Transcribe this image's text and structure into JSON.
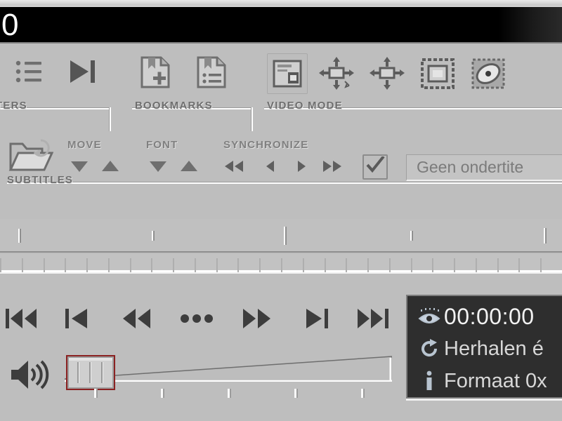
{
  "window": {
    "osd_text": "0",
    "background_color": "#bebebe",
    "video_area_color": "#000000"
  },
  "toolbar": {
    "groups": [
      {
        "caption": "TERS",
        "full_caption": "FILTERS",
        "buttons": [
          {
            "name": "filters-list-icon",
            "label": "Filters list"
          },
          {
            "name": "play-to-end-icon",
            "label": "Play to end"
          }
        ]
      },
      {
        "caption": "BOOKMARKS",
        "buttons": [
          {
            "name": "add-bookmark-icon",
            "label": "Add bookmark"
          },
          {
            "name": "bookmark-list-icon",
            "label": "Bookmark list"
          }
        ]
      },
      {
        "caption": "VIDEO MODE",
        "buttons": [
          {
            "name": "window-mode-icon",
            "label": "Window mode"
          },
          {
            "name": "stretch-aspect-icon",
            "label": "Stretch to aspect"
          },
          {
            "name": "stretch-fill-icon",
            "label": "Stretch to fill"
          },
          {
            "name": "fullscreen-icon",
            "label": "Fullscreen"
          },
          {
            "name": "overlay-settings-icon",
            "label": "Overlay settings"
          }
        ]
      }
    ]
  },
  "subtitles": {
    "caption": "SUBTITLES",
    "open_button": {
      "name": "open-subtitle-icon",
      "label": "Open subtitle file"
    },
    "move": {
      "label": "MOVE",
      "down": "Move down",
      "up": "Move up"
    },
    "font": {
      "label": "FONT",
      "smaller": "Smaller font",
      "larger": "Larger font"
    },
    "synchronize": {
      "label": "SYNCHRONIZE",
      "fast_back": "Sync back fast",
      "back": "Sync back",
      "forward": "Sync forward",
      "fast_forward": "Sync forward fast"
    },
    "enabled_checkbox": {
      "name": "subtitle-enable-checkbox",
      "checked": true
    },
    "selected_subtitle": "Geen ondertite",
    "selected_subtitle_full": "Geen ondertitels"
  },
  "timeline": {
    "markers_percent": [
      3.3,
      27,
      50.5,
      73,
      96.8
    ],
    "marker_heights": [
      20,
      14,
      26,
      14,
      22
    ],
    "ruler_tick_count": 26
  },
  "transport": {
    "buttons": [
      {
        "name": "skip-to-start-button",
        "label": "Skip to start"
      },
      {
        "name": "previous-chapter-button",
        "label": "Previous"
      },
      {
        "name": "rewind-button",
        "label": "Rewind"
      },
      {
        "name": "more-button",
        "label": "More"
      },
      {
        "name": "fast-forward-button",
        "label": "Fast forward"
      },
      {
        "name": "next-chapter-button",
        "label": "Next"
      },
      {
        "name": "skip-to-end-button",
        "label": "Skip to end"
      }
    ],
    "volume": {
      "name": "volume-slider",
      "speaker_icon": "speaker-icon",
      "value_percent": 4,
      "tick_count": 5
    }
  },
  "info_panel": {
    "background_color": "#2e2e2e",
    "lines": [
      {
        "icon": "eye-icon",
        "text": "00:00:00"
      },
      {
        "icon": "repeat-icon",
        "text": "Herhalen é"
      },
      {
        "icon": "info-icon",
        "text": "Formaat 0x"
      }
    ]
  }
}
